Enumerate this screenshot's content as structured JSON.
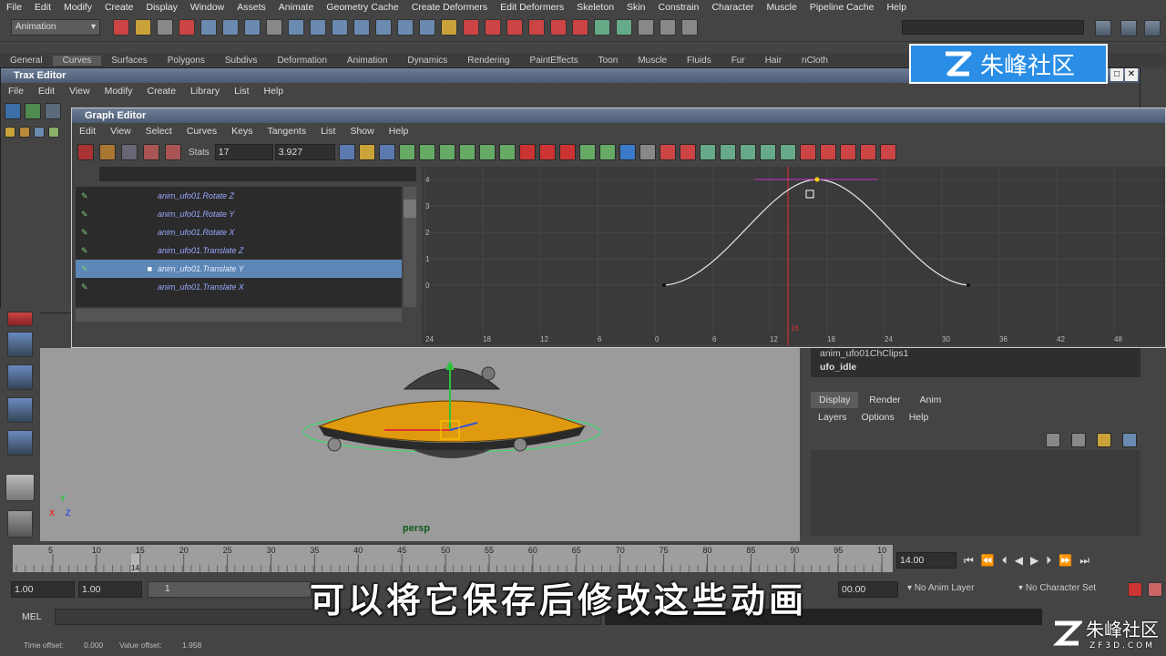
{
  "main_menu": [
    "File",
    "Edit",
    "Modify",
    "Create",
    "Display",
    "Window",
    "Assets",
    "Animate",
    "Geometry Cache",
    "Create Deformers",
    "Edit Deformers",
    "Skeleton",
    "Skin",
    "Constrain",
    "Character",
    "Muscle",
    "Pipeline Cache",
    "Help"
  ],
  "mode_selector": "Animation",
  "shelf_tabs": [
    "General",
    "Curves",
    "Surfaces",
    "Polygons",
    "Subdivs",
    "Deformation",
    "Animation",
    "Dynamics",
    "Rendering",
    "PaintEffects",
    "Toon",
    "Muscle",
    "Fluids",
    "Fur",
    "Hair",
    "nCloth"
  ],
  "active_shelf_tab": "Curves",
  "trax": {
    "title": "Trax Editor",
    "menu": [
      "File",
      "Edit",
      "View",
      "Modify",
      "Create",
      "Library",
      "List",
      "Help"
    ]
  },
  "graph_editor": {
    "title": "Graph Editor",
    "menu": [
      "Edit",
      "View",
      "Select",
      "Curves",
      "Keys",
      "Tangents",
      "List",
      "Show",
      "Help"
    ],
    "stats_label": "Stats",
    "stats_frame": "17",
    "stats_value": "3.927",
    "curves": [
      "anim_ufo01.Rotate Z",
      "anim_ufo01.Rotate Y",
      "anim_ufo01.Rotate X",
      "anim_ufo01.Translate Z",
      "anim_ufo01.Translate Y",
      "anim_ufo01.Translate X"
    ],
    "selected_index": 4,
    "y_ticks": [
      "4",
      "3",
      "2",
      "1",
      "0"
    ],
    "x_ticks": [
      "24",
      "18",
      "12",
      "6",
      "0",
      "6",
      "12",
      "18",
      "24",
      "30",
      "36",
      "42",
      "48"
    ],
    "current_frame_label": "16"
  },
  "viewport": {
    "camera_label": "persp",
    "axis_y": "Y",
    "axis_x": "X",
    "axis_z": "Z"
  },
  "channel_box": {
    "clips": [
      "anim_ufo01ChClips1",
      "ufo_idle"
    ],
    "tabs": [
      "Display",
      "Render",
      "Anim"
    ],
    "active_tab": "Display",
    "layer_menu": [
      "Layers",
      "Options",
      "Help"
    ]
  },
  "timeline": {
    "ticks": [
      "5",
      "10",
      "15",
      "20",
      "25",
      "30",
      "35",
      "40",
      "45",
      "50",
      "55",
      "60",
      "65",
      "70",
      "75",
      "80",
      "85",
      "90",
      "95",
      "10"
    ],
    "current_frame": "14",
    "current_time_field": "14.00"
  },
  "range": {
    "start": "1.00",
    "playback_start": "1.00",
    "slider_start": "1",
    "end_field": "00.00",
    "anim_layer": "No Anim Layer",
    "character_set": "No Character Set"
  },
  "command_line": {
    "label": "MEL"
  },
  "help_line": {
    "time_offset_label": "Time offset:",
    "time_offset": "0.000",
    "value_offset_label": "Value offset:",
    "value_offset": "1.958"
  },
  "subtitle": "可以将它保存后修改这些动画",
  "logo_text": "朱峰社区",
  "watermark_text": "朱峰社区",
  "watermark_url": "ZF3D.COM",
  "colors": {
    "selection": "#5c87b6",
    "accent_logo": "#2a8ee6",
    "curve": "#e6e6e6",
    "time_marker": "#e23030"
  }
}
